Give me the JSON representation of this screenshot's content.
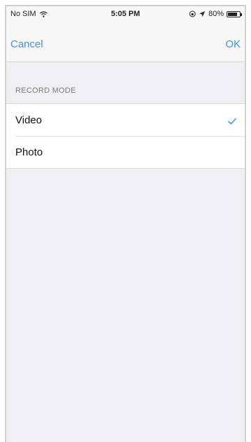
{
  "status_bar": {
    "carrier": "No SIM",
    "time": "5:05 PM",
    "battery": "80%",
    "battery_level": 0.8
  },
  "nav": {
    "cancel_label": "Cancel",
    "ok_label": "OK"
  },
  "record_mode": {
    "header": "RECORD MODE",
    "options": [
      {
        "label": "Video",
        "selected": true
      },
      {
        "label": "Photo",
        "selected": false
      }
    ]
  },
  "colors": {
    "accent": "#4a8fd6",
    "background": "#efeff4"
  },
  "icons": {
    "wifi": "wifi-icon",
    "location": "location-arrow-icon",
    "lock_rotation": "orientation-lock-icon",
    "battery": "battery-icon",
    "check": "checkmark-icon"
  }
}
